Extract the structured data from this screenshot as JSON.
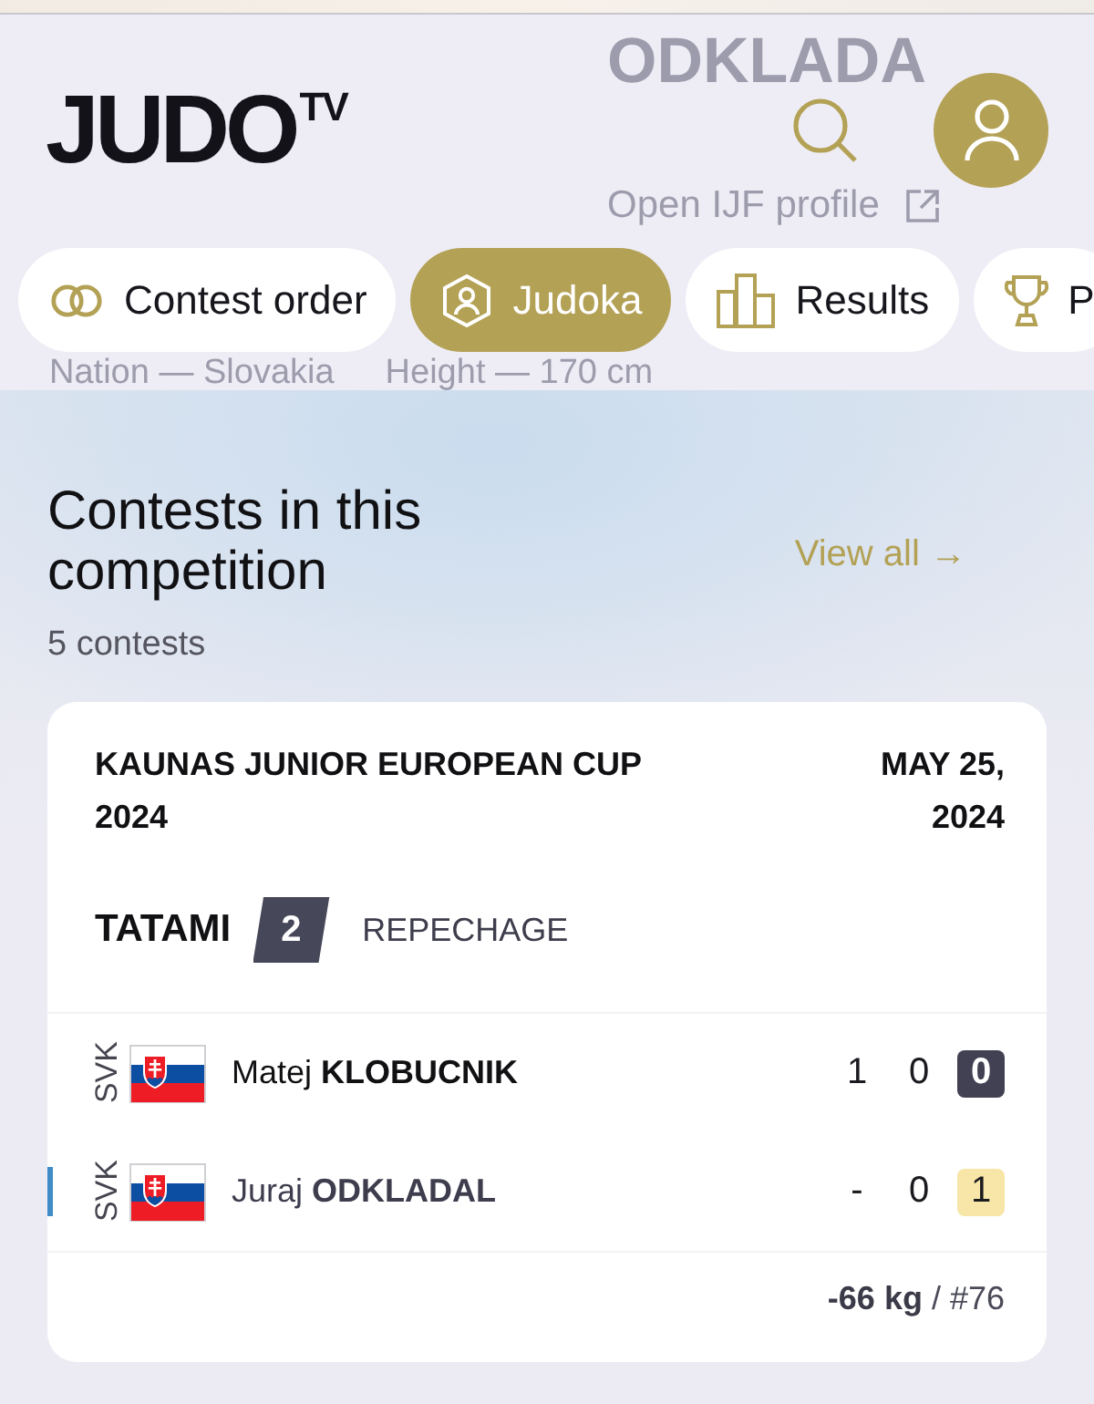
{
  "header": {
    "logo": {
      "main": "JUDO",
      "superscript": "TV"
    }
  },
  "profile_backdrop": {
    "name": "ODKLADA",
    "link": "Open IJF profile",
    "details": [
      "Nation — Slovakia",
      "Height — 170 cm"
    ]
  },
  "tabs": [
    {
      "label": "Contest order",
      "kind": "rings",
      "selected": false
    },
    {
      "label": "Judoka",
      "kind": "judoka",
      "selected": true
    },
    {
      "label": "Results",
      "kind": "bars",
      "selected": false
    },
    {
      "label": "P",
      "kind": "trophy",
      "selected": false
    }
  ],
  "section": {
    "title": "Contests in this competition",
    "count": "5 contests",
    "link": "View all →"
  },
  "contests": [
    {
      "event": "KAUNAS JUNIOR EUROPEAN CUP 2024",
      "date": "MAY 25, 2024",
      "tatami_label": "TATAMI",
      "tatami": "2",
      "round": "REPECHAGE",
      "competitors": [
        {
          "country": "SVK",
          "first_name": "Matej",
          "last_name": "KLOBUCNIK",
          "winner": true,
          "selected": false,
          "scores": [
            "1",
            "0"
          ],
          "penalties": "0",
          "highlighted": false
        },
        {
          "country": "SVK",
          "first_name": "Juraj",
          "last_name": "ODKLADAL",
          "winner": false,
          "selected": true,
          "scores": [
            "-",
            "0"
          ],
          "penalties": "1",
          "highlighted": true
        }
      ],
      "category": "**-66 kg** / #76"
    }
  ]
}
